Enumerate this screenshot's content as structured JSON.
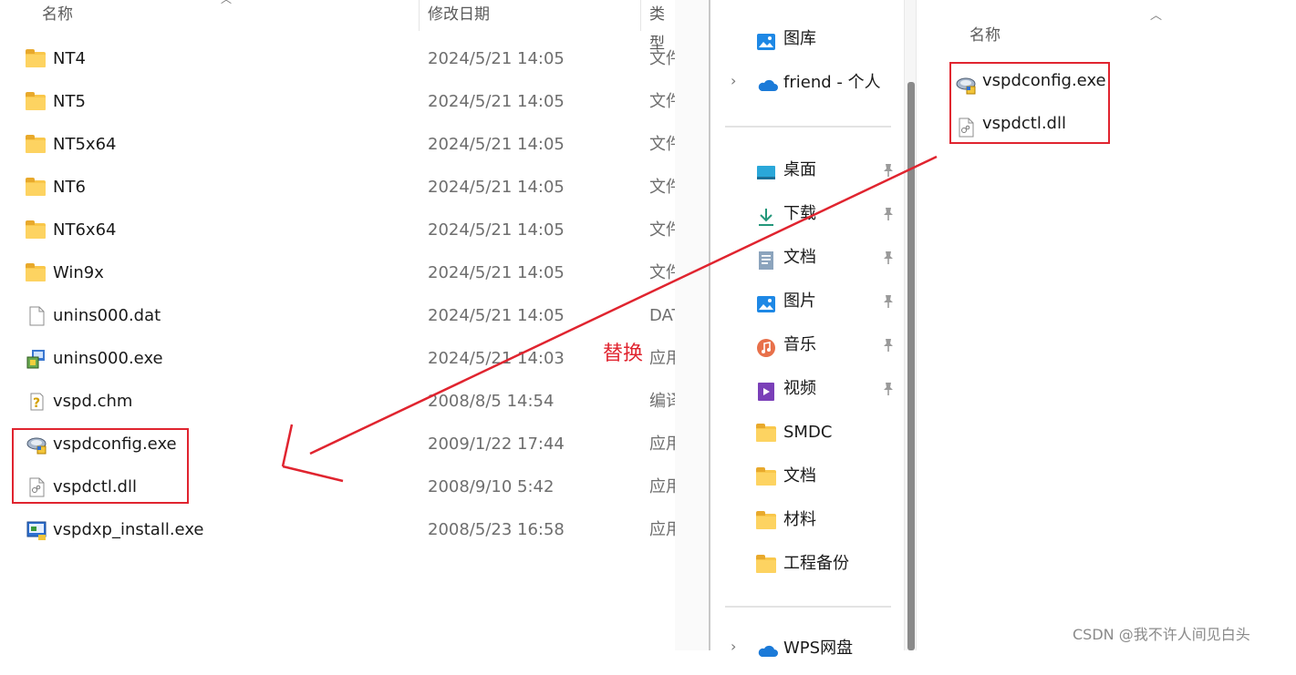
{
  "left_pane": {
    "columns": {
      "name": "名称",
      "date": "修改日期",
      "type": "类型"
    },
    "rows": [
      {
        "name": "NT4",
        "date": "2024/5/21 14:05",
        "type": "文件夹",
        "icon": "folder-icon"
      },
      {
        "name": "NT5",
        "date": "2024/5/21 14:05",
        "type": "文件夹",
        "icon": "folder-icon"
      },
      {
        "name": "NT5x64",
        "date": "2024/5/21 14:05",
        "type": "文件夹",
        "icon": "folder-icon"
      },
      {
        "name": "NT6",
        "date": "2024/5/21 14:05",
        "type": "文件夹",
        "icon": "folder-icon"
      },
      {
        "name": "NT6x64",
        "date": "2024/5/21 14:05",
        "type": "文件夹",
        "icon": "folder-icon"
      },
      {
        "name": "Win9x",
        "date": "2024/5/21 14:05",
        "type": "文件夹",
        "icon": "folder-icon"
      },
      {
        "name": "unins000.dat",
        "date": "2024/5/21 14:05",
        "type": "DAT",
        "icon": "file-icon"
      },
      {
        "name": "unins000.exe",
        "date": "2024/5/21 14:03",
        "type": "应用",
        "icon": "installer-icon"
      },
      {
        "name": "vspd.chm",
        "date": "2008/8/5 14:54",
        "type": "编译",
        "icon": "help-file-icon"
      },
      {
        "name": "vspdconfig.exe",
        "date": "2009/1/22 17:44",
        "type": "应用",
        "icon": "config-app-icon"
      },
      {
        "name": "vspdctl.dll",
        "date": "2008/9/10 5:42",
        "type": "应用",
        "icon": "dll-file-icon"
      },
      {
        "name": "vspdxp_install.exe",
        "date": "2008/5/23 16:58",
        "type": "应用",
        "icon": "setup-icon"
      }
    ]
  },
  "right_pane": {
    "nav_top": [
      {
        "label": "图库",
        "icon": "gallery-icon"
      },
      {
        "label": "friend - 个人",
        "icon": "onedrive-cloud-icon"
      }
    ],
    "quick_access": [
      {
        "label": "桌面",
        "icon": "desktop-icon",
        "pinned": true
      },
      {
        "label": "下载",
        "icon": "download-icon",
        "pinned": true
      },
      {
        "label": "文档",
        "icon": "documents-icon",
        "pinned": true
      },
      {
        "label": "图片",
        "icon": "pictures-icon",
        "pinned": true
      },
      {
        "label": "音乐",
        "icon": "music-icon",
        "pinned": true
      },
      {
        "label": "视频",
        "icon": "videos-icon",
        "pinned": true
      },
      {
        "label": "SMDC",
        "icon": "folder-icon",
        "pinned": false
      },
      {
        "label": "文档",
        "icon": "folder-icon",
        "pinned": false
      },
      {
        "label": "材料",
        "icon": "folder-icon",
        "pinned": false
      },
      {
        "label": "工程备份",
        "icon": "folder-icon",
        "pinned": false
      }
    ],
    "nav_bottom": {
      "label": "WPS网盘",
      "icon": "wps-cloud-icon"
    },
    "column_header": "名称",
    "files": [
      {
        "name": "vspdconfig.exe",
        "icon": "config-app-icon"
      },
      {
        "name": "vspdctl.dll",
        "icon": "dll-file-icon"
      }
    ]
  },
  "annotation": {
    "label": "替换",
    "color": "#e0242f"
  },
  "watermark": "CSDN @我不许人间见白头"
}
